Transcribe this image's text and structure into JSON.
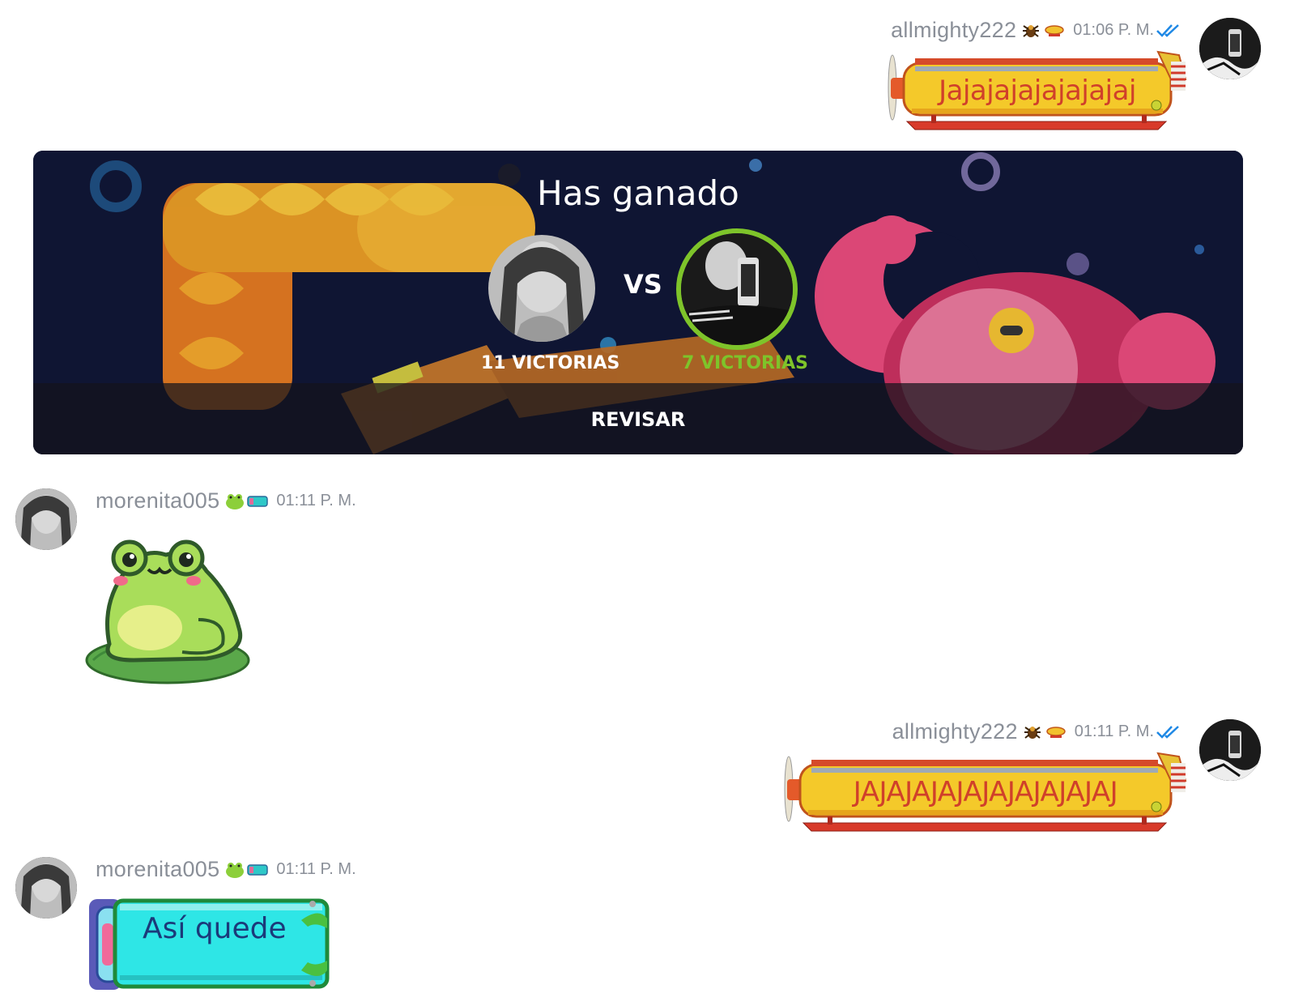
{
  "messages": [
    {
      "id": "m1",
      "username": "allmighty222",
      "time": "01:06 P. M.",
      "text": "Jajajajajajajajaj",
      "bubble": "airship",
      "side": "right",
      "read": true
    },
    {
      "id": "m2",
      "type": "game-result",
      "title": "Has ganado",
      "vs_label": "VS",
      "left_wins": "11 VICTORIAS",
      "right_wins": "7 VICTORIAS",
      "action": "REVISAR",
      "winner_color": "#7ec42a"
    },
    {
      "id": "m3",
      "username": "morenita005",
      "time": "01:11 P. M.",
      "sticker": "frog-sticker",
      "side": "left"
    },
    {
      "id": "m4",
      "username": "allmighty222",
      "time": "01:11 P. M.",
      "text": "JAJAJAJAJAJAJAJAJAJAJ",
      "bubble": "airship",
      "side": "right",
      "read": true
    },
    {
      "id": "m5",
      "username": "morenita005",
      "time": "01:11 P. M.",
      "text": "Así quede",
      "bubble": "cyan-frog",
      "side": "left"
    }
  ],
  "colors": {
    "username": "#8a8f98",
    "read_check": "#1e88e5",
    "airship_text": "#d0402a",
    "card_bg": "#0f1533",
    "cyan_bubble": "#2ee6e6"
  },
  "icons": [
    "bug-badge-icon",
    "airship-badge-icon",
    "frog-badge-icon",
    "double-check-icon"
  ]
}
